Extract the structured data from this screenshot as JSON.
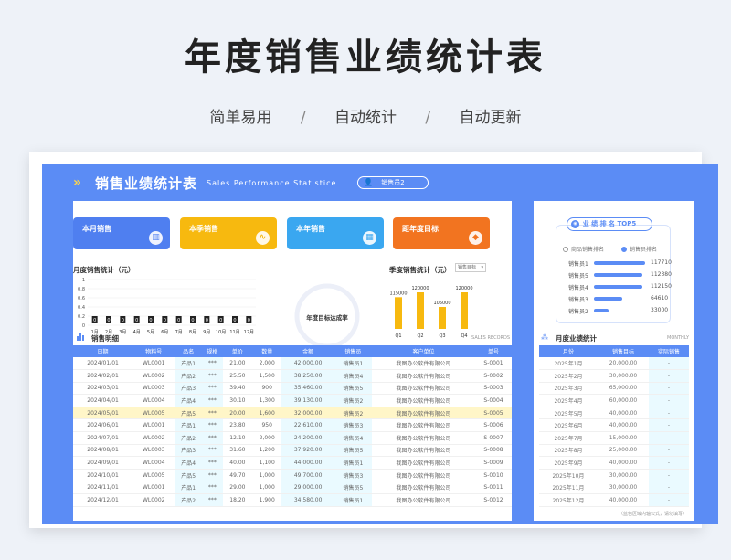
{
  "poster": {
    "title": "年度销售业绩统计表",
    "tags": [
      "简单易用",
      "自动统计",
      "自动更新"
    ],
    "separator": "/"
  },
  "header": {
    "logo_icon": "double-chevron-icon",
    "title": "销售业绩统计表",
    "subtitle_en": "Sales Performance Statistice",
    "selector_value": "销售员2"
  },
  "cards": [
    {
      "label": "本月销售",
      "color": "#4f7ff0",
      "icon": "bar-chart-icon"
    },
    {
      "label": "本季销售",
      "color": "#f7b90f",
      "icon": "trend-icon"
    },
    {
      "label": "本年销售",
      "color": "#3aa7f0",
      "icon": "calendar-icon"
    },
    {
      "label": "距年度目标",
      "color": "#f27420",
      "icon": "ticket-icon"
    }
  ],
  "monthly_chart": {
    "title": "月度销售统计（元）",
    "y_ticks": [
      "1",
      "0.8",
      "0.6",
      "0.4",
      "0.2",
      "0"
    ],
    "categories": [
      "1月",
      "2月",
      "3月",
      "4月",
      "5月",
      "6月",
      "7月",
      "8月",
      "9月",
      "10月",
      "11月",
      "12月"
    ],
    "value_labels": [
      "0",
      "0",
      "0",
      "0",
      "0",
      "0",
      "0",
      "0",
      "0",
      "0",
      "0",
      "0"
    ]
  },
  "gauge": {
    "label": "年度目标达成率"
  },
  "quarter_chart": {
    "title": "季度销售统计（元）",
    "dropdown": "销售目标",
    "categories": [
      "Q1",
      "Q2",
      "Q3",
      "Q4"
    ],
    "value_labels": [
      "115000",
      "120000",
      "105000",
      "120000"
    ]
  },
  "chart_data": [
    {
      "type": "bar",
      "title": "月度销售统计（元）",
      "categories": [
        "1月",
        "2月",
        "3月",
        "4月",
        "5月",
        "6月",
        "7月",
        "8月",
        "9月",
        "10月",
        "11月",
        "12月"
      ],
      "values": [
        0,
        0,
        0,
        0,
        0,
        0,
        0,
        0,
        0,
        0,
        0,
        0
      ],
      "ylim": [
        0,
        1
      ]
    },
    {
      "type": "bar",
      "title": "季度销售统计（元）",
      "categories": [
        "Q1",
        "Q2",
        "Q3",
        "Q4"
      ],
      "values": [
        115000,
        120000,
        105000,
        120000
      ]
    }
  ],
  "detail": {
    "title": "销售明细",
    "title_en": "SALES RECORDS",
    "columns": [
      "日期",
      "物料号",
      "品名",
      "规格",
      "单价",
      "数量",
      "金额",
      "销售员",
      "客户单位",
      "单号"
    ],
    "rows": [
      [
        "2024/01/01",
        "WL0001",
        "产品1",
        "***",
        "21.00",
        "2,000",
        "42,000.00",
        "销售员1",
        "我图办公软件有限公司",
        "S-0001"
      ],
      [
        "2024/02/01",
        "WL0002",
        "产品2",
        "***",
        "25.50",
        "1,500",
        "38,250.00",
        "销售员4",
        "我图办公软件有限公司",
        "S-0002"
      ],
      [
        "2024/03/01",
        "WL0003",
        "产品3",
        "***",
        "39.40",
        "900",
        "35,460.00",
        "销售员5",
        "我图办公软件有限公司",
        "S-0003"
      ],
      [
        "2024/04/01",
        "WL0004",
        "产品4",
        "***",
        "30.10",
        "1,300",
        "39,130.00",
        "销售员2",
        "我图办公软件有限公司",
        "S-0004"
      ],
      [
        "2024/05/01",
        "WL0005",
        "产品5",
        "***",
        "20.00",
        "1,600",
        "32,000.00",
        "销售员2",
        "我图办公软件有限公司",
        "S-0005"
      ],
      [
        "2024/06/01",
        "WL0001",
        "产品1",
        "***",
        "23.80",
        "950",
        "22,610.00",
        "销售员3",
        "我图办公软件有限公司",
        "S-0006"
      ],
      [
        "2024/07/01",
        "WL0002",
        "产品2",
        "***",
        "12.10",
        "2,000",
        "24,200.00",
        "销售员4",
        "我图办公软件有限公司",
        "S-0007"
      ],
      [
        "2024/08/01",
        "WL0003",
        "产品3",
        "***",
        "31.60",
        "1,200",
        "37,920.00",
        "销售员5",
        "我图办公软件有限公司",
        "S-0008"
      ],
      [
        "2024/09/01",
        "WL0004",
        "产品4",
        "***",
        "40.00",
        "1,100",
        "44,000.00",
        "销售员1",
        "我图办公软件有限公司",
        "S-0009"
      ],
      [
        "2024/10/01",
        "WL0005",
        "产品5",
        "***",
        "49.70",
        "1,000",
        "49,700.00",
        "销售员3",
        "我图办公软件有限公司",
        "S-0010"
      ],
      [
        "2024/11/01",
        "WL0001",
        "产品1",
        "***",
        "29.00",
        "1,000",
        "29,000.00",
        "销售员5",
        "我图办公软件有限公司",
        "S-0011"
      ],
      [
        "2024/12/01",
        "WL0002",
        "产品2",
        "***",
        "18.20",
        "1,900",
        "34,580.00",
        "销售员1",
        "我图办公软件有限公司",
        "S-0012"
      ]
    ],
    "highlight_row": 4
  },
  "ranking": {
    "title": "业 绩 排 名 TOP5",
    "options": [
      "商品销售排名",
      "销售员排名"
    ],
    "rows": [
      {
        "name": "销售员1",
        "value": "117710",
        "pct": 100
      },
      {
        "name": "销售员5",
        "value": "112380",
        "pct": 95
      },
      {
        "name": "销售员4",
        "value": "112150",
        "pct": 95
      },
      {
        "name": "销售员3",
        "value": "64610",
        "pct": 55
      },
      {
        "name": "销售员2",
        "value": "33000",
        "pct": 28
      }
    ]
  },
  "monthly_stats": {
    "title": "月度业绩统计",
    "title_en": "MONTHLY",
    "columns": [
      "月份",
      "销售目标",
      "实际销售"
    ],
    "rows": [
      [
        "2025年1月",
        "20,000.00",
        "-"
      ],
      [
        "2025年2月",
        "30,000.00",
        "-"
      ],
      [
        "2025年3月",
        "65,000.00",
        "-"
      ],
      [
        "2025年4月",
        "60,000.00",
        "-"
      ],
      [
        "2025年5月",
        "40,000.00",
        "-"
      ],
      [
        "2025年6月",
        "40,000.00",
        "-"
      ],
      [
        "2025年7月",
        "15,000.00",
        "-"
      ],
      [
        "2025年8月",
        "25,000.00",
        "-"
      ],
      [
        "2025年9月",
        "40,000.00",
        "-"
      ],
      [
        "2025年10月",
        "30,000.00",
        "-"
      ],
      [
        "2025年11月",
        "30,000.00",
        "-"
      ],
      [
        "2025年12月",
        "40,000.00",
        "-"
      ]
    ],
    "footnote": "（蓝色区域内轴公式，请勿填写）"
  }
}
